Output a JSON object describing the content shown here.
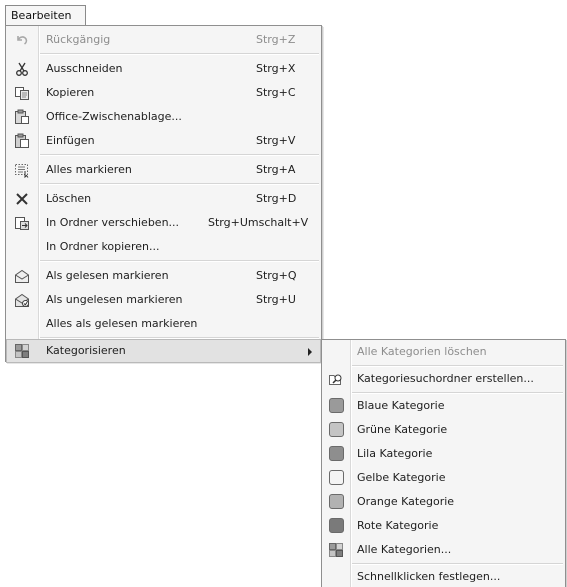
{
  "menubar": {
    "edit_label": "Bearbeiten"
  },
  "main_menu": {
    "undo": {
      "label": "Rückgängig",
      "shortcut": "Strg+Z"
    },
    "cut": {
      "label": "Ausschneiden",
      "shortcut": "Strg+X"
    },
    "copy": {
      "label": "Kopieren",
      "shortcut": "Strg+C"
    },
    "office_clipboard": {
      "label": "Office-Zwischenablage..."
    },
    "paste": {
      "label": "Einfügen",
      "shortcut": "Strg+V"
    },
    "select_all": {
      "label": "Alles markieren",
      "shortcut": "Strg+A"
    },
    "delete": {
      "label": "Löschen",
      "shortcut": "Strg+D"
    },
    "move_to_folder": {
      "label": "In Ordner verschieben...",
      "shortcut": "Strg+Umschalt+V"
    },
    "copy_to_folder": {
      "label": "In Ordner kopieren..."
    },
    "mark_read": {
      "label": "Als gelesen markieren",
      "shortcut": "Strg+Q"
    },
    "mark_unread": {
      "label": "Als ungelesen markieren",
      "shortcut": "Strg+U"
    },
    "mark_all_read": {
      "label": "Alles als gelesen markieren"
    },
    "categorize": {
      "label": "Kategorisieren"
    }
  },
  "sub_menu": {
    "clear_all": {
      "label": "Alle Kategorien löschen"
    },
    "create_search_folder": {
      "label": "Kategoriesuchordner erstellen..."
    },
    "categories": [
      {
        "label": "Blaue Kategorie",
        "color": "#9a9a9a"
      },
      {
        "label": "Grüne Kategorie",
        "color": "#c4c4c4"
      },
      {
        "label": "Lila Kategorie",
        "color": "#8e8e8e"
      },
      {
        "label": "Gelbe Kategorie",
        "color": "#f4f4f4"
      },
      {
        "label": "Orange Kategorie",
        "color": "#b2b2b2"
      },
      {
        "label": "Rote Kategorie",
        "color": "#7a7a7a"
      }
    ],
    "all_categories": {
      "label": "Alle Kategorien..."
    },
    "set_quick_click": {
      "label": "Schnellklicken festlegen..."
    }
  }
}
